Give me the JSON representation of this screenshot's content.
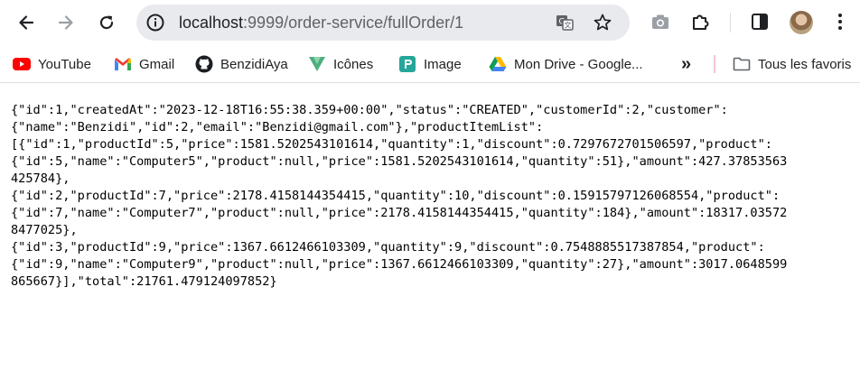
{
  "browser": {
    "url_host": "localhost",
    "url_path": ":9999/order-service/fullOrder/1"
  },
  "bookmarks": [
    {
      "label": "YouTube",
      "icon": "youtube-icon"
    },
    {
      "label": "Gmail",
      "icon": "gmail-icon"
    },
    {
      "label": "BenzidiAya",
      "icon": "github-icon"
    },
    {
      "label": "Icônes",
      "icon": "vuetify-icon"
    },
    {
      "label": "Image",
      "icon": "image-app-icon"
    },
    {
      "label": "Mon Drive - Google...",
      "icon": "google-drive-icon"
    }
  ],
  "overflow_label": "»",
  "all_bookmarks_label": "Tous les favoris",
  "json_lines": [
    "{\"id\":1,\"createdAt\":\"2023-12-18T16:55:38.359+00:00\",\"status\":\"CREATED\",\"customerId\":2,\"customer\":",
    "{\"name\":\"Benzidi\",\"id\":2,\"email\":\"Benzidi@gmail.com\"},\"productItemList\":",
    "[{\"id\":1,\"productId\":5,\"price\":1581.5202543101614,\"quantity\":1,\"discount\":0.7297672701506597,\"product\":",
    "{\"id\":5,\"name\":\"Computer5\",\"product\":null,\"price\":1581.5202543101614,\"quantity\":51},\"amount\":427.37853563",
    "425784},",
    "{\"id\":2,\"productId\":7,\"price\":2178.4158144354415,\"quantity\":10,\"discount\":0.15915797126068554,\"product\":",
    "{\"id\":7,\"name\":\"Computer7\",\"product\":null,\"price\":2178.4158144354415,\"quantity\":184},\"amount\":18317.03572",
    "8477025},",
    "{\"id\":3,\"productId\":9,\"price\":1367.6612466103309,\"quantity\":9,\"discount\":0.7548885517387854,\"product\":",
    "{\"id\":9,\"name\":\"Computer9\",\"product\":null,\"price\":1367.6612466103309,\"quantity\":27},\"amount\":3017.0648599",
    "865667}],\"total\":21761.479124097852}"
  ],
  "colors": {
    "omnibox_bg": "#e8eaed",
    "icon_gray": "#5f6368",
    "text": "#202124"
  }
}
